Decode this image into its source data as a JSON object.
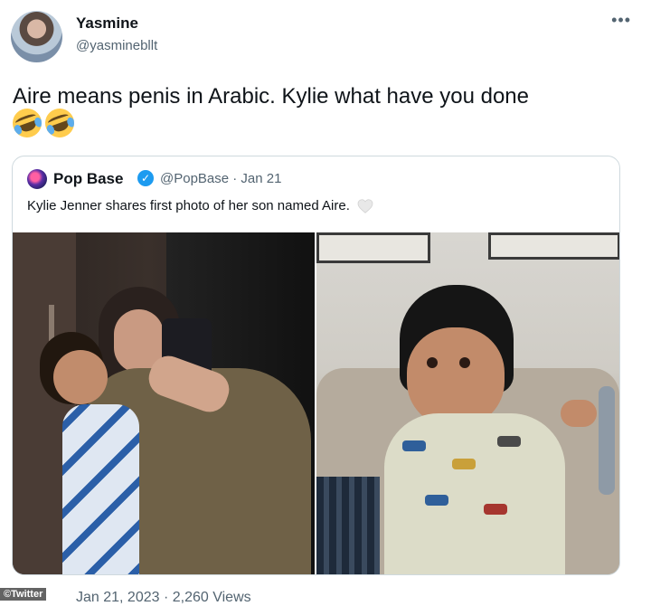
{
  "tweet": {
    "display_name": "Yasmine",
    "handle": "@yasminebllt",
    "text": "Aire means penis in Arabic. Kylie what have you done",
    "more_icon": "more-options-icon",
    "footer": "Jan 21, 2023 · 2,260 Views"
  },
  "quoted_tweet": {
    "display_name": "Pop Base",
    "verified_icon": "verified-badge-icon",
    "meta": "@PopBase · Jan 21",
    "text": "Kylie Jenner shares first photo of her son named Aire.",
    "heart_icon": "white-heart-icon"
  },
  "credit": "©Twitter",
  "colors": {
    "secondary_text": "#536471",
    "border": "#cfd9de",
    "verified": "#1d9bf0"
  }
}
